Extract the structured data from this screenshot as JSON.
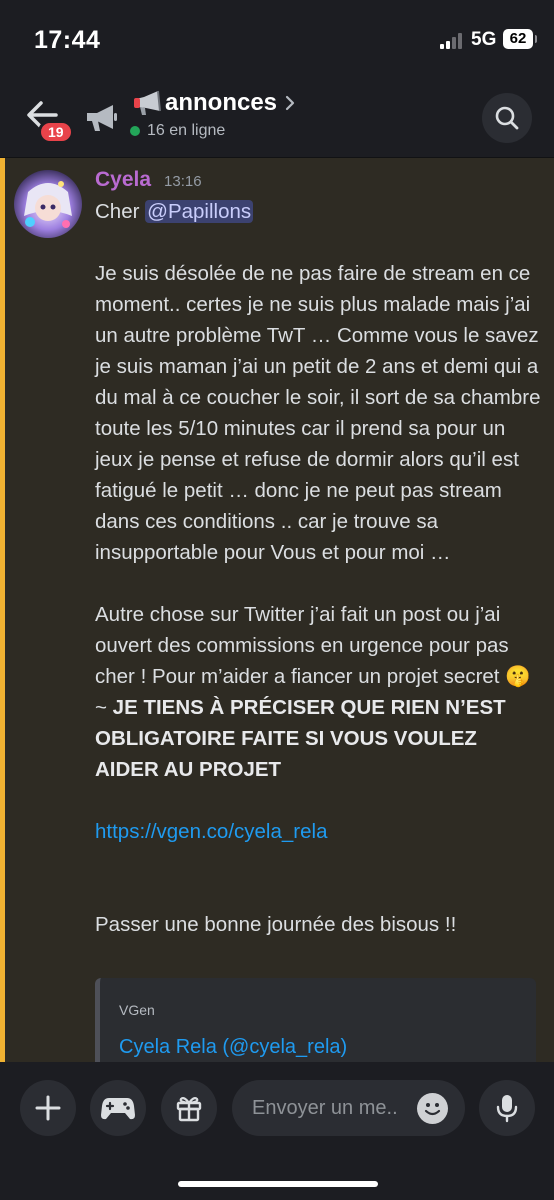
{
  "status_bar": {
    "time": "17:44",
    "network": "5G",
    "battery": "62"
  },
  "header": {
    "unread_badge": "19",
    "channel_name": "annonces",
    "online": "16 en ligne"
  },
  "message": {
    "author": "Cyela",
    "time": "13:16",
    "greeting": "Cher ",
    "mention": "@Papillons",
    "paragraph1": "Je suis désolée de ne pas faire de stream en ce moment.. certes je ne suis plus malade mais j’ai un autre problème TwT … Comme vous le savez je suis maman j’ai un petit de 2 ans et demi qui a du mal à ce coucher le soir, il sort de sa chambre toute les 5/10 minutes car il prend sa pour un jeux je pense et refuse de dormir alors qu’il est fatigué le petit … donc je ne peut pas stream dans ces conditions .. car je trouve sa insupportable pour Vous et pour moi …",
    "paragraph2": "Autre chose sur Twitter j’ai fait un post ou j’ai ouvert des commissions en urgence pour pas cher ! Pour m’aider a fiancer un projet secret ",
    "paragraph2_emoji": "🤫",
    "paragraph2_tilde": " ~ ",
    "paragraph2_bold": "JE TIENS À PRÉCISER QUE RIEN N’EST OBLIGATOIRE FAITE SI VOUS VOULEZ AIDER AU PROJET",
    "link": "https://vgen.co/cyela_rela",
    "closing": "Passer une bonne journée des bisous !!"
  },
  "embed": {
    "provider": "VGen",
    "title": "Cyela Rela (@cyela_rela)"
  },
  "composer": {
    "placeholder": "Envoyer un me.."
  },
  "colors": {
    "highlight_bar": "#f0b232",
    "message_bg": "#2e2b23",
    "author": "#b96bd1",
    "link": "#1f9bf0",
    "badge": "#e8434a",
    "online": "#23a559"
  }
}
